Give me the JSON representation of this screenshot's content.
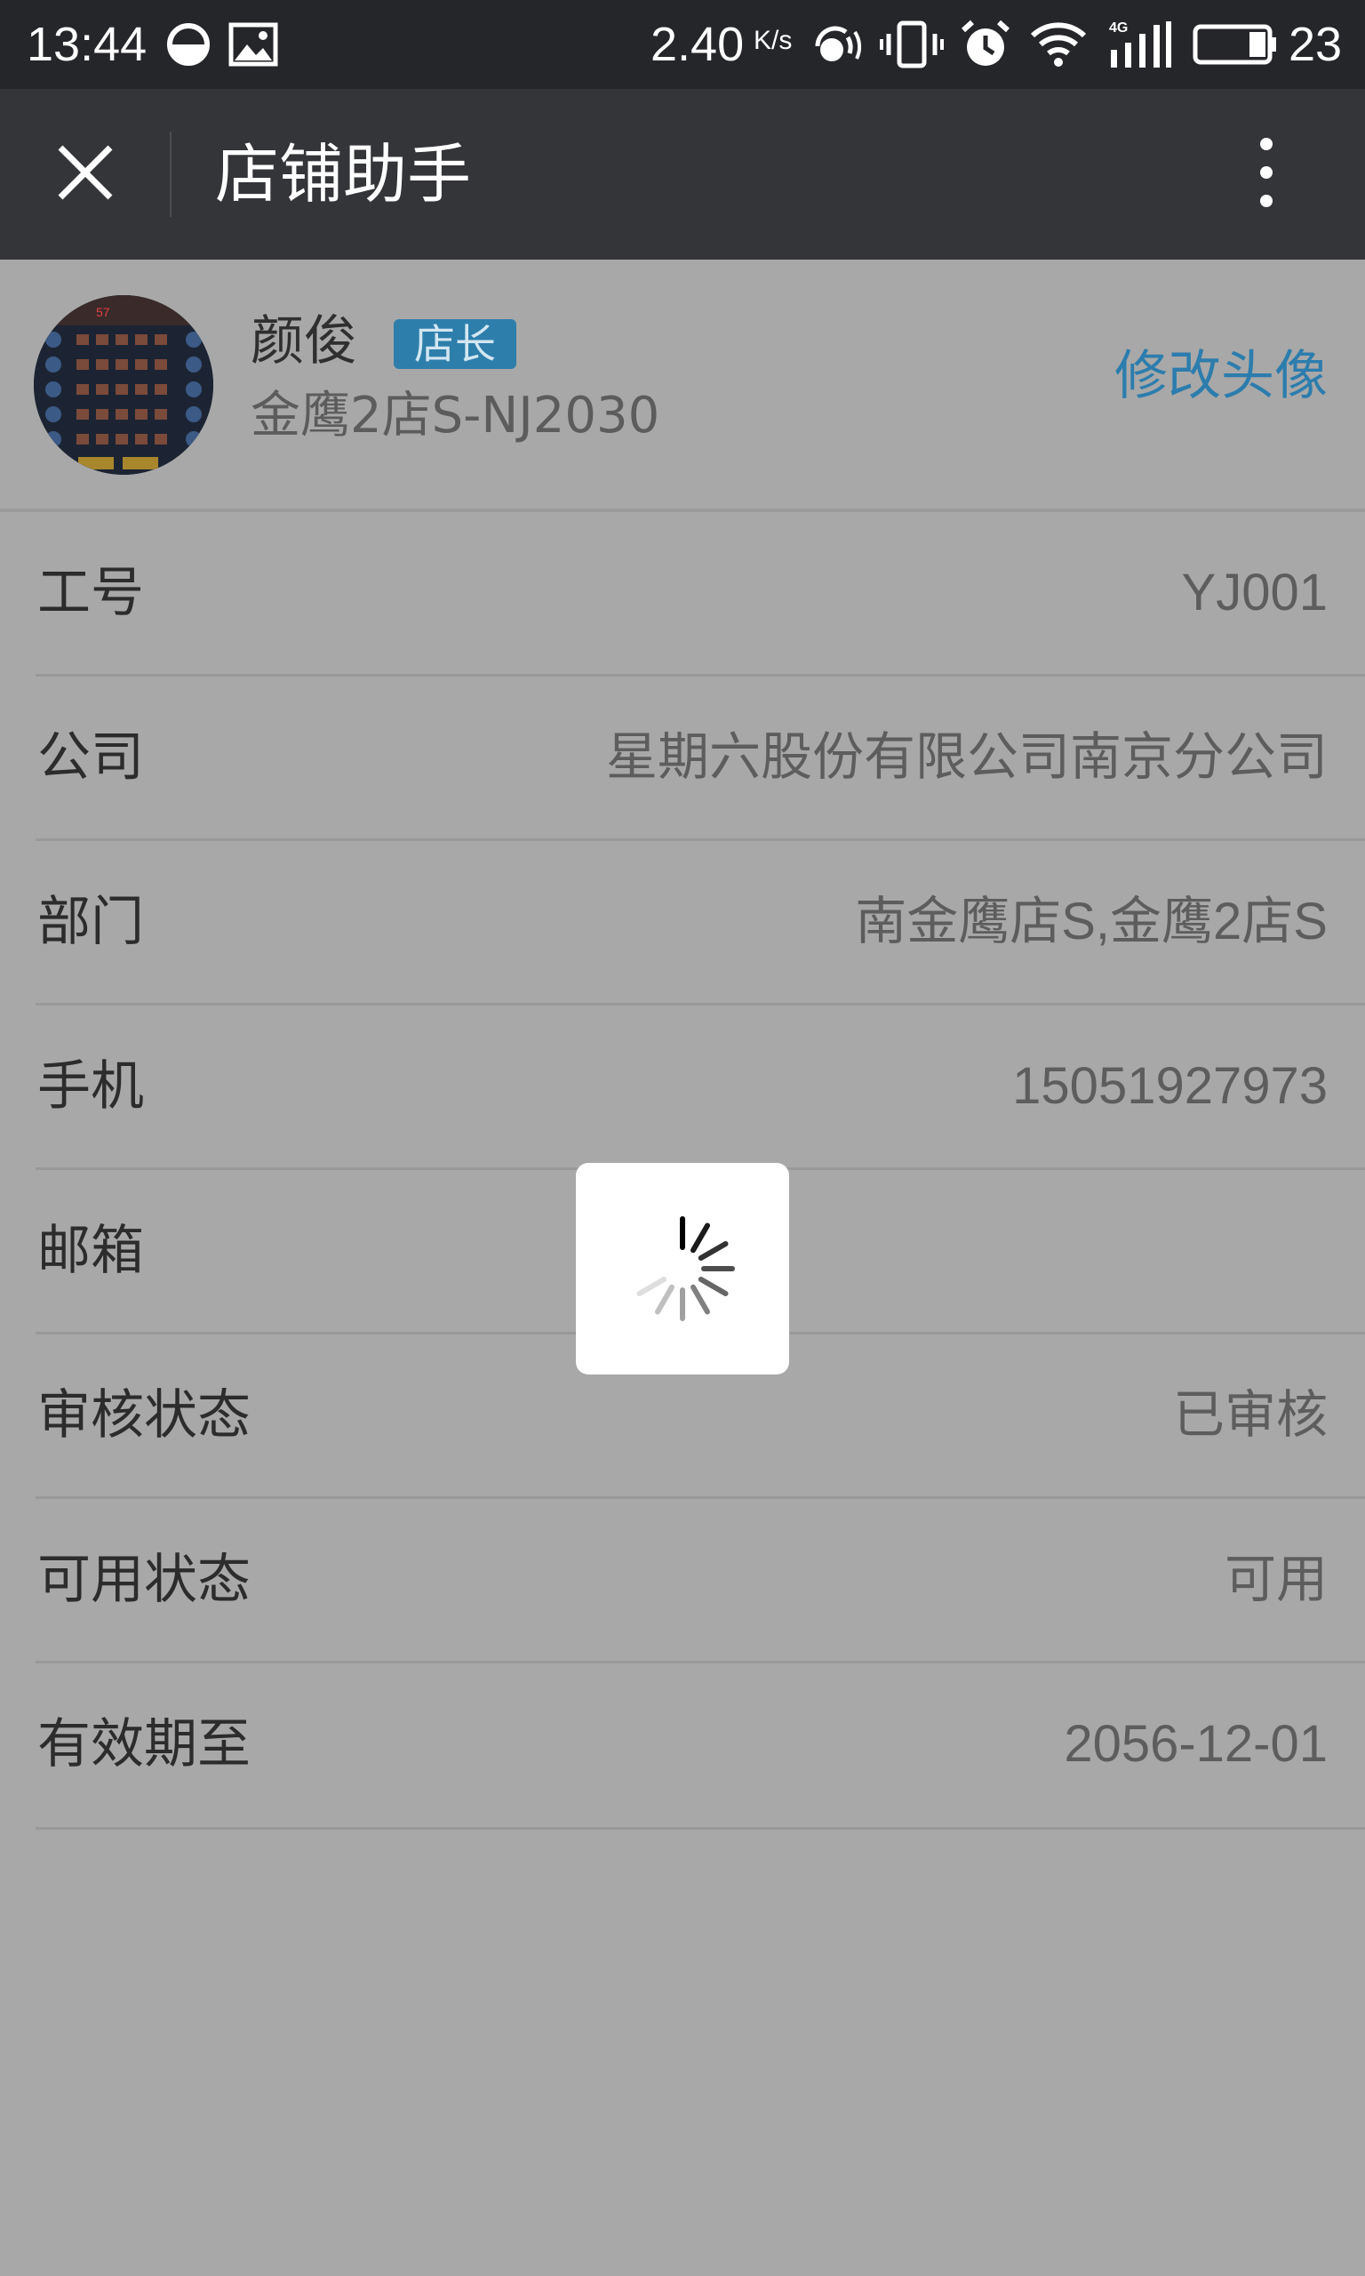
{
  "status_bar": {
    "time": "13:44",
    "net_speed": "2.40",
    "net_speed_unit": "K/s",
    "battery_percent": "23",
    "icons": [
      "data-saver-icon",
      "image-icon",
      "hotspot-icon",
      "vibrate-icon",
      "alarm-icon",
      "wifi-icon",
      "signal-4g-icon",
      "battery-icon"
    ]
  },
  "app_bar": {
    "title": "店铺助手",
    "close_icon": "close-icon",
    "more_icon": "more-vertical-icon"
  },
  "profile": {
    "name": "颜俊",
    "role_badge": "店长",
    "store_code": "金鹰2店S-NJ2030",
    "change_avatar_label": "修改头像"
  },
  "info_rows": [
    {
      "label": "工号",
      "value": "YJ001"
    },
    {
      "label": "公司",
      "value": "星期六股份有限公司南京分公司"
    },
    {
      "label": "部门",
      "value": "南金鹰店S,金鹰2店S"
    },
    {
      "label": "手机",
      "value": "15051927973"
    },
    {
      "label": "邮箱",
      "value": ""
    },
    {
      "label": "审核状态",
      "value": "已审核"
    },
    {
      "label": "可用状态",
      "value": "可用"
    },
    {
      "label": "有效期至",
      "value": "2056-12-01"
    }
  ],
  "loading": {
    "icon": "loading-spinner-icon"
  },
  "colors": {
    "status_bar_bg": "#25262a",
    "app_bar_bg": "#343539",
    "overlay_bg": "#a8a8a8",
    "accent": "#2c7dad",
    "badge_bg": "#2d7eab"
  }
}
